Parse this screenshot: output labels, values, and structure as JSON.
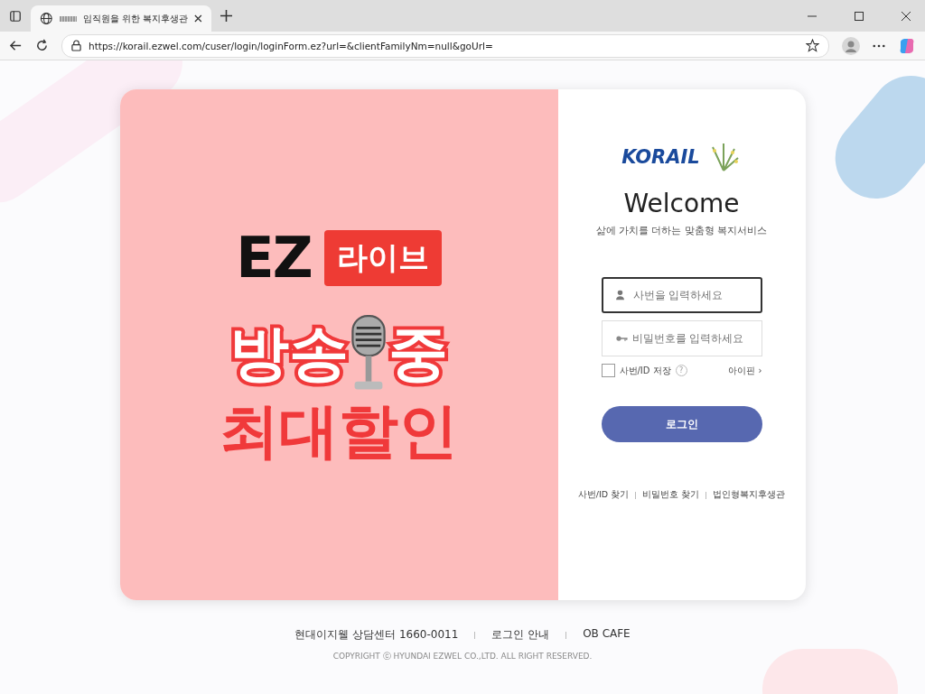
{
  "browser": {
    "tab_title": "임직원을 위한 복지후생관",
    "url": "https://korail.ezwel.com/cuser/login/loginForm.ez?url=&clientFamilyNm=null&goUrl="
  },
  "banner": {
    "brand": "EZ",
    "badge": "라이브",
    "line1_start": "방송",
    "line1_end": "중",
    "line2": "최대할인"
  },
  "login": {
    "logo_text": "KORAIL",
    "title": "Welcome",
    "subtitle": "삶에 가치를 더하는 맞춤형 복지서비스",
    "id_field": {
      "placeholder": "사번을 입력하세요",
      "focused": true
    },
    "pw_field": {
      "placeholder": "비밀번호를 입력하세요",
      "focused": false
    },
    "save_id": {
      "label": "사번/ID 저장",
      "checked": false
    },
    "help": "?",
    "ipin": "아이핀 ›",
    "submit": "로그인",
    "links": [
      "사번/ID 찾기",
      "비밀번호 찾기",
      "법인형복지후생관"
    ]
  },
  "footer": {
    "links": [
      "현대이지웰 상담센터 1660-0011",
      "로그인 안내",
      "OB CAFE"
    ],
    "copyright": "COPYRIGHT ⓒ HYUNDAI EZWEL CO.,LTD. ALL RIGHT RESERVED."
  }
}
